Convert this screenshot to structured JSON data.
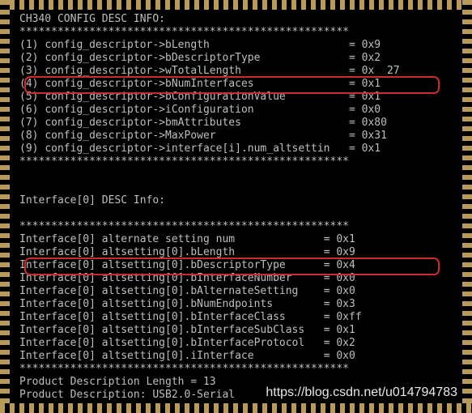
{
  "title": "CH340 CONFIG DESC INFO:",
  "stars": "****************************************************",
  "cfg": [
    {
      "n": "(1)",
      "k": "config_descriptor->bLength",
      "v": "= 0x9"
    },
    {
      "n": "(2)",
      "k": "config_descriptor->bDescriptorType",
      "v": "= 0x2"
    },
    {
      "n": "(3)",
      "k": "config_descriptor->wTotalLength",
      "v": "= 0x  27"
    },
    {
      "n": "(4)",
      "k": "config_descriptor->bNumInterfaces",
      "v": "= 0x1"
    },
    {
      "n": "(5)",
      "k": "config_descriptor->bConfigurationValue",
      "v": "= 0x1"
    },
    {
      "n": "(6)",
      "k": "config_descriptor->iConfiguration",
      "v": "= 0x0"
    },
    {
      "n": "(7)",
      "k": "config_descriptor->bmAttributes",
      "v": "= 0x80"
    },
    {
      "n": "(8)",
      "k": "config_descriptor->MaxPower",
      "v": "= 0x31"
    },
    {
      "n": "(9)",
      "k": "config_descriptor->interface[i].num_altsettin",
      "v": "= 0x1"
    }
  ],
  "iface_title": "Interface[0] DESC Info:",
  "iface_hl": {
    "k": "Interface[0] alternate setting num",
    "v": "= 0x1"
  },
  "iface": [
    {
      "k": "Interface[0] altsetting[0].bLength",
      "v": "= 0x9"
    },
    {
      "k": "Interface[0] altsetting[0].bDescriptorType",
      "v": "= 0x4"
    },
    {
      "k": "Interface[0] altsetting[0].bInterfaceNumber",
      "v": "= 0x0"
    },
    {
      "k": "Interface[0] altsetting[0].bAlternateSetting",
      "v": "= 0x0"
    },
    {
      "k": "Interface[0] altsetting[0].bNumEndpoints",
      "v": "= 0x3"
    },
    {
      "k": "Interface[0] altsetting[0].bInterfaceClass",
      "v": "= 0xff"
    },
    {
      "k": "Interface[0] altsetting[0].bInterfaceSubClass",
      "v": "= 0x1"
    },
    {
      "k": "Interface[0] altsetting[0].bInterfaceProtocol",
      "v": "= 0x2"
    },
    {
      "k": "Interface[0] altsetting[0].iInterface",
      "v": "= 0x0"
    }
  ],
  "prod_len": "Product Description Length = 13",
  "prod_desc": "Product Description: USB2.0-Serial",
  "url": "https://blog.csdn.net/u014794783",
  "col1": 370
}
